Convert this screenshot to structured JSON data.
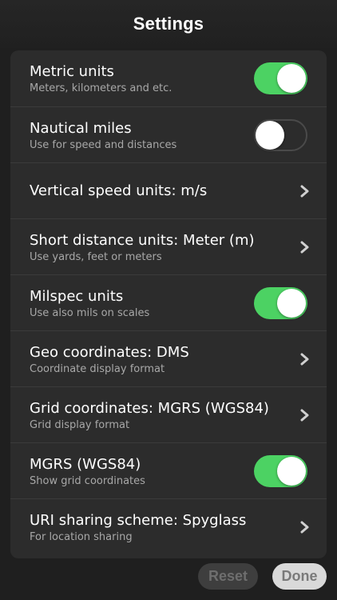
{
  "header": {
    "title": "Settings"
  },
  "colors": {
    "toggle_on": "#4cd263",
    "panel_bg": "#2c2c2c",
    "app_bg": "#1f1f1f"
  },
  "rows": [
    {
      "label": "Metric units",
      "subtitle": "Meters, kilometers and etc.",
      "control": "toggle",
      "on": true
    },
    {
      "label": "Nautical miles",
      "subtitle": "Use for speed and distances",
      "control": "toggle",
      "on": false
    },
    {
      "label": "Vertical speed units: m/s",
      "subtitle": "",
      "control": "chevron"
    },
    {
      "label": "Short distance units: Meter (m)",
      "subtitle": "Use yards, feet or meters",
      "control": "chevron"
    },
    {
      "label": "Milspec units",
      "subtitle": "Use also mils on scales",
      "control": "toggle",
      "on": true
    },
    {
      "label": "Geo coordinates: DMS",
      "subtitle": "Coordinate display format",
      "control": "chevron"
    },
    {
      "label": "Grid coordinates: MGRS (WGS84)",
      "subtitle": "Grid display format",
      "control": "chevron"
    },
    {
      "label": "MGRS (WGS84)",
      "subtitle": "Show grid coordinates",
      "control": "toggle",
      "on": true
    },
    {
      "label": "URI sharing scheme: Spyglass",
      "subtitle": "For location sharing",
      "control": "chevron"
    }
  ],
  "footer": {
    "reset_label": "Reset",
    "done_label": "Done"
  }
}
